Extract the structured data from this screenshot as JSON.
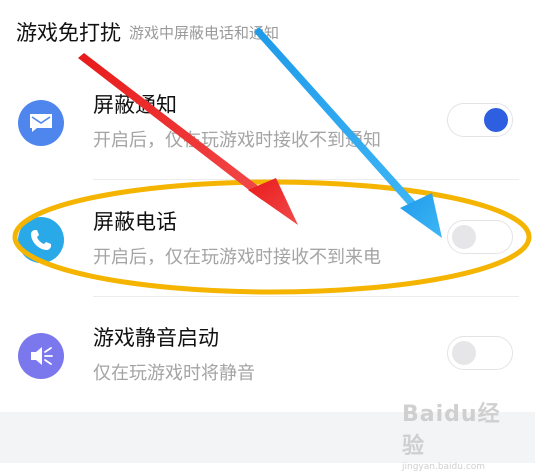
{
  "section": {
    "title": "游戏免打扰",
    "subtitle": "游戏中屏蔽电话和通知"
  },
  "items": [
    {
      "title": "屏蔽通知",
      "description": "开启后，仅在玩游戏时接收不到通知",
      "enabled": true,
      "icon": "message-icon",
      "icon_color": "#4f86ee"
    },
    {
      "title": "屏蔽电话",
      "description": "开启后，仅在玩游戏时接收不到来电",
      "enabled": false,
      "icon": "phone-icon",
      "icon_color": "#2aa9e8"
    },
    {
      "title": "游戏静音启动",
      "description": "仅在玩游戏时将静音",
      "enabled": false,
      "icon": "mute-speaker-icon",
      "icon_color": "#7a78ec"
    }
  ],
  "watermark": {
    "brand": "Baidu经验",
    "url": "jingyan.baidu.com"
  },
  "colors": {
    "toggle_on": "#2d5fe0",
    "toggle_off_knob": "#e6e6e8",
    "annotation_red": "#ef2323",
    "annotation_blue": "#29a5f0",
    "annotation_ellipse": "#f4b400"
  }
}
